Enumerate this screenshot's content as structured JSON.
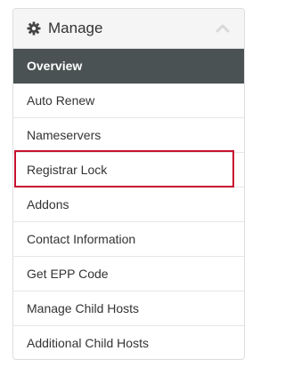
{
  "panel": {
    "title": "Manage",
    "icon": "gear-icon",
    "collapse_icon": "chevron-up-icon"
  },
  "menu": {
    "items": [
      {
        "label": "Overview",
        "active": true
      },
      {
        "label": "Auto Renew",
        "active": false
      },
      {
        "label": "Nameservers",
        "active": false
      },
      {
        "label": "Registrar Lock",
        "active": false,
        "highlighted": true
      },
      {
        "label": "Addons",
        "active": false
      },
      {
        "label": "Contact Information",
        "active": false
      },
      {
        "label": "Get EPP Code",
        "active": false
      },
      {
        "label": "Manage Child Hosts",
        "active": false
      },
      {
        "label": "Additional Child Hosts",
        "active": false
      }
    ]
  },
  "colors": {
    "active_bg": "#4b5253",
    "highlight_border": "#c8102e",
    "header_bg": "#f5f5f5"
  }
}
